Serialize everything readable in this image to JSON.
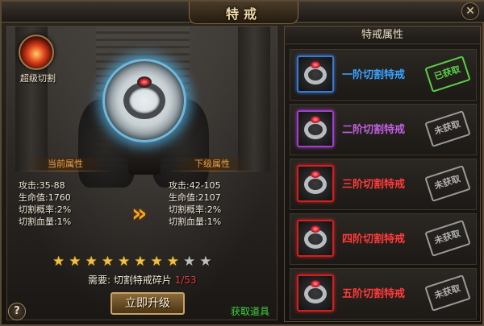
{
  "window": {
    "title": "特戒",
    "close_label": "✕"
  },
  "skill": {
    "label": "超级切割",
    "icon": "fire-ring-skill-icon"
  },
  "preview": {
    "icon": "silver-ring-ruby-icon"
  },
  "current": {
    "tab": "当前属性",
    "stats": [
      "攻击:35-88",
      "生命值:1760",
      "切割概率:2%",
      "切割血量:1%"
    ]
  },
  "next": {
    "tab": "下级属性",
    "stats": [
      "攻击:42-105",
      "生命值:2107",
      "切割概率:2%",
      "切割血量:1%"
    ]
  },
  "arrow_glyph": "»",
  "stars": {
    "total": 10,
    "lit": 8
  },
  "requirement": {
    "prefix": "需要: 切割特戒碎片 ",
    "count": "1/53"
  },
  "buttons": {
    "upgrade": "立即升级",
    "help": "?",
    "get_items": "获取道具"
  },
  "ring_list": {
    "header": "特戒属性",
    "items": [
      {
        "name": "一阶切割特戒",
        "color": "#3aa0ff",
        "border": "#3a78d0",
        "stamp": "已获取",
        "obtained": true
      },
      {
        "name": "二阶切割特戒",
        "color": "#c060e0",
        "border": "#a040c8",
        "stamp": "未获取",
        "obtained": false
      },
      {
        "name": "三阶切割特戒",
        "color": "#ff3a3a",
        "border": "#d02020",
        "stamp": "未获取",
        "obtained": false
      },
      {
        "name": "四阶切割特戒",
        "color": "#ff3a3a",
        "border": "#d02020",
        "stamp": "未获取",
        "obtained": false
      },
      {
        "name": "五阶切割特戒",
        "color": "#ff3a3a",
        "border": "#d02020",
        "stamp": "未获取",
        "obtained": false
      }
    ]
  }
}
